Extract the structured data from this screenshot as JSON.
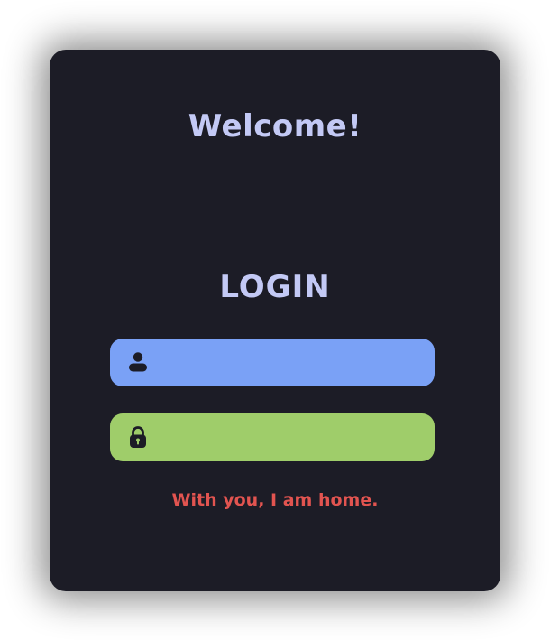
{
  "header": {
    "welcome_text": "Welcome!"
  },
  "login": {
    "title": "LOGIN",
    "username": {
      "icon": "user-icon",
      "value": "",
      "placeholder": "",
      "color": "#7aa1f6"
    },
    "password": {
      "icon": "lock-icon",
      "value": "",
      "placeholder": "",
      "color": "#9fcd6a"
    }
  },
  "footer": {
    "tagline": "With you, I am home."
  },
  "colors": {
    "card_background": "#1c1c26",
    "title_color": "#c3c9f5",
    "tagline_color": "#e25450"
  }
}
